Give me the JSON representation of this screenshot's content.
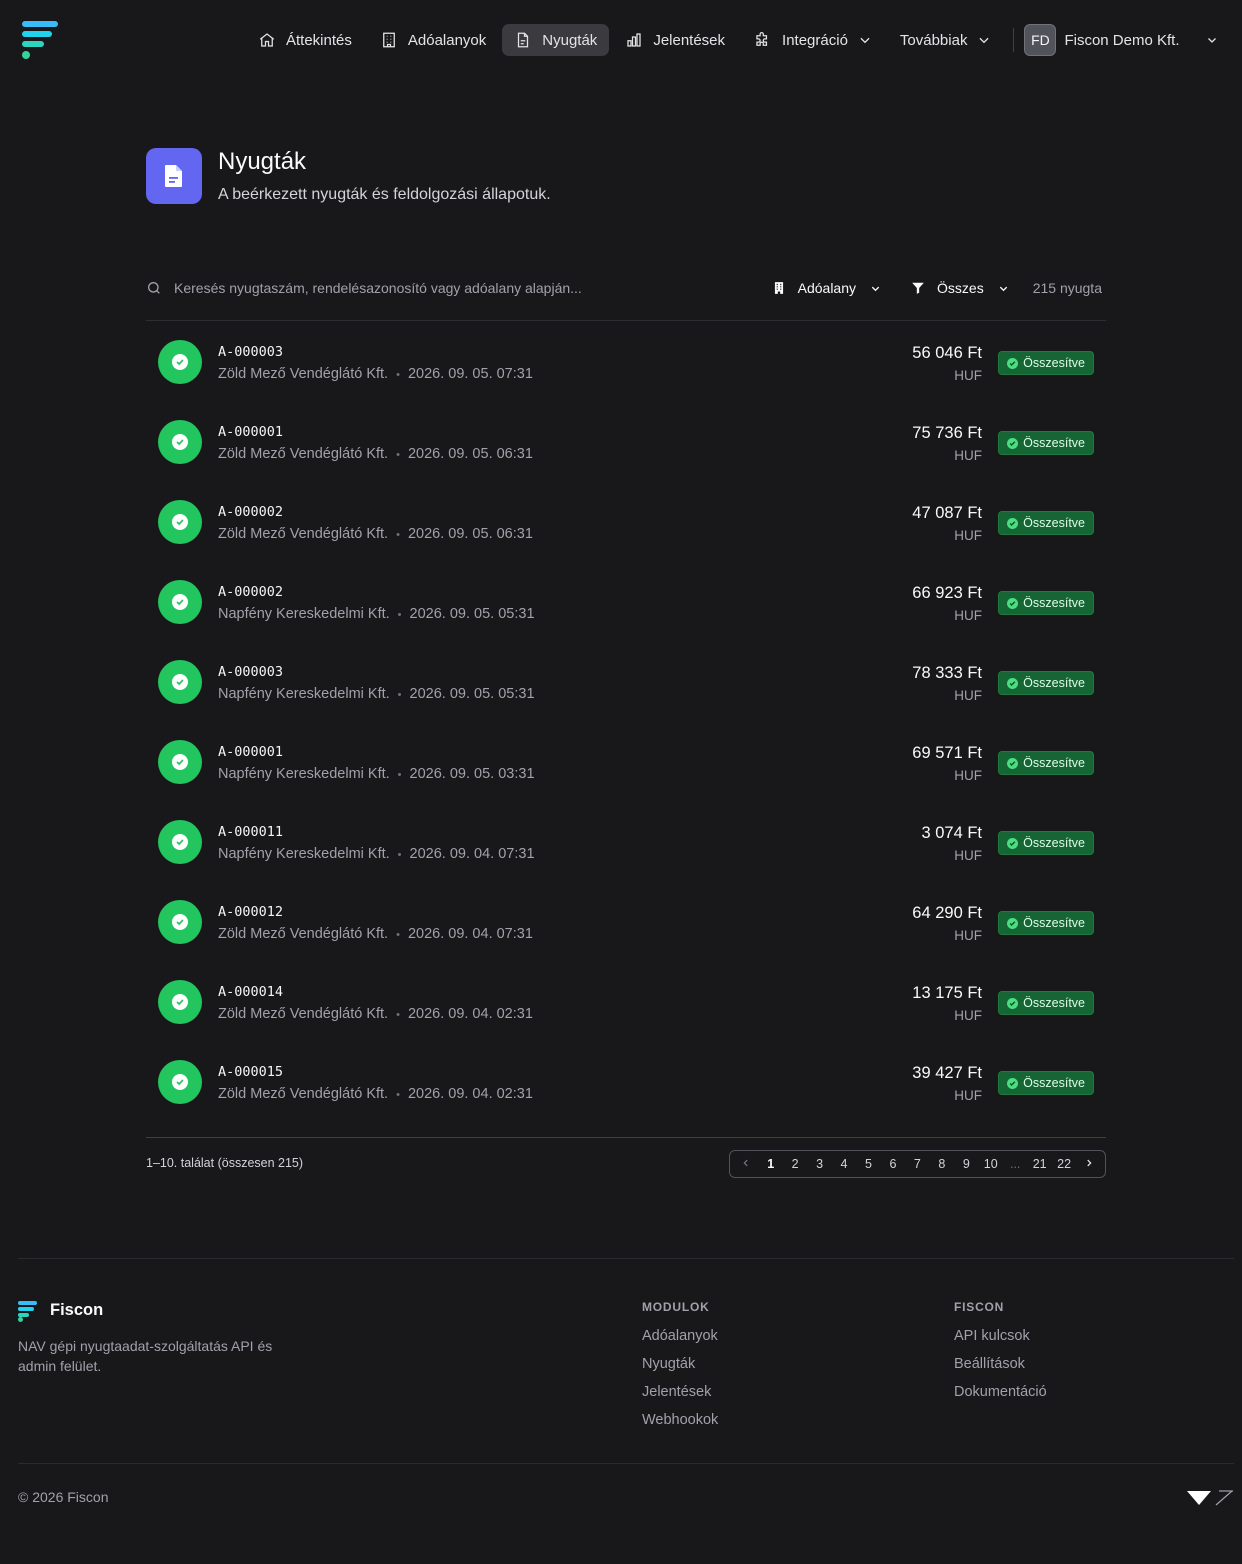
{
  "nav": {
    "items": [
      {
        "label": "Áttekintés",
        "icon": "home-icon"
      },
      {
        "label": "Adóalanyok",
        "icon": "building-icon"
      },
      {
        "label": "Nyugták",
        "icon": "document-icon",
        "active": true
      },
      {
        "label": "Jelentések",
        "icon": "bar-chart-icon"
      },
      {
        "label": "Integráció",
        "icon": "puzzle-icon",
        "dropdown": true
      },
      {
        "label": "Továbbiak",
        "dropdown": true
      }
    ],
    "org_initials": "FD",
    "org_name": "Fiscon Demo Kft."
  },
  "header": {
    "title": "Nyugták",
    "subtitle": "A beérkezett nyugták és feldolgozási állapotuk."
  },
  "toolbar": {
    "search_placeholder": "Keresés nyugtaszám, rendelésazonosító vagy adóalany alapján...",
    "entity_filter": "Adóalany",
    "status_filter": "Összes",
    "count": "215 nyugta"
  },
  "receipts": [
    {
      "id": "A-000003",
      "entity": "Zöld Mező Vendéglátó Kft.",
      "date": "2026. 09. 05. 07:31",
      "amount": "56 046 Ft",
      "currency": "HUF",
      "status": "Összesítve"
    },
    {
      "id": "A-000001",
      "entity": "Zöld Mező Vendéglátó Kft.",
      "date": "2026. 09. 05. 06:31",
      "amount": "75 736 Ft",
      "currency": "HUF",
      "status": "Összesítve"
    },
    {
      "id": "A-000002",
      "entity": "Zöld Mező Vendéglátó Kft.",
      "date": "2026. 09. 05. 06:31",
      "amount": "47 087 Ft",
      "currency": "HUF",
      "status": "Összesítve"
    },
    {
      "id": "A-000002",
      "entity": "Napfény Kereskedelmi Kft.",
      "date": "2026. 09. 05. 05:31",
      "amount": "66 923 Ft",
      "currency": "HUF",
      "status": "Összesítve"
    },
    {
      "id": "A-000003",
      "entity": "Napfény Kereskedelmi Kft.",
      "date": "2026. 09. 05. 05:31",
      "amount": "78 333 Ft",
      "currency": "HUF",
      "status": "Összesítve"
    },
    {
      "id": "A-000001",
      "entity": "Napfény Kereskedelmi Kft.",
      "date": "2026. 09. 05. 03:31",
      "amount": "69 571 Ft",
      "currency": "HUF",
      "status": "Összesítve"
    },
    {
      "id": "A-000011",
      "entity": "Napfény Kereskedelmi Kft.",
      "date": "2026. 09. 04. 07:31",
      "amount": "3 074 Ft",
      "currency": "HUF",
      "status": "Összesítve"
    },
    {
      "id": "A-000012",
      "entity": "Zöld Mező Vendéglátó Kft.",
      "date": "2026. 09. 04. 07:31",
      "amount": "64 290 Ft",
      "currency": "HUF",
      "status": "Összesítve"
    },
    {
      "id": "A-000014",
      "entity": "Zöld Mező Vendéglátó Kft.",
      "date": "2026. 09. 04. 02:31",
      "amount": "13 175 Ft",
      "currency": "HUF",
      "status": "Összesítve"
    },
    {
      "id": "A-000015",
      "entity": "Zöld Mező Vendéglátó Kft.",
      "date": "2026. 09. 04. 02:31",
      "amount": "39 427 Ft",
      "currency": "HUF",
      "status": "Összesítve"
    }
  ],
  "pagination": {
    "results": "1–10. találat (összesen 215)",
    "pages": [
      "1",
      "2",
      "3",
      "4",
      "5",
      "6",
      "7",
      "8",
      "9",
      "10",
      "...",
      "21",
      "22"
    ],
    "current": "1"
  },
  "footer": {
    "brand": "Fiscon",
    "description": "NAV gépi nyugtaadat-szolgáltatás API és admin felület.",
    "modules_heading": "MODULOK",
    "modules": [
      "Adóalanyok",
      "Nyugták",
      "Jelentések",
      "Webhookok"
    ],
    "fiscon_heading": "FISCON",
    "fiscon_links": [
      "API kulcsok",
      "Beállítások",
      "Dokumentáció"
    ],
    "copyright": "© 2026 Fiscon"
  },
  "colors": {
    "background": "#18181b",
    "accent": "#6366f1",
    "success": "#22c55e",
    "badge": "#166534"
  }
}
